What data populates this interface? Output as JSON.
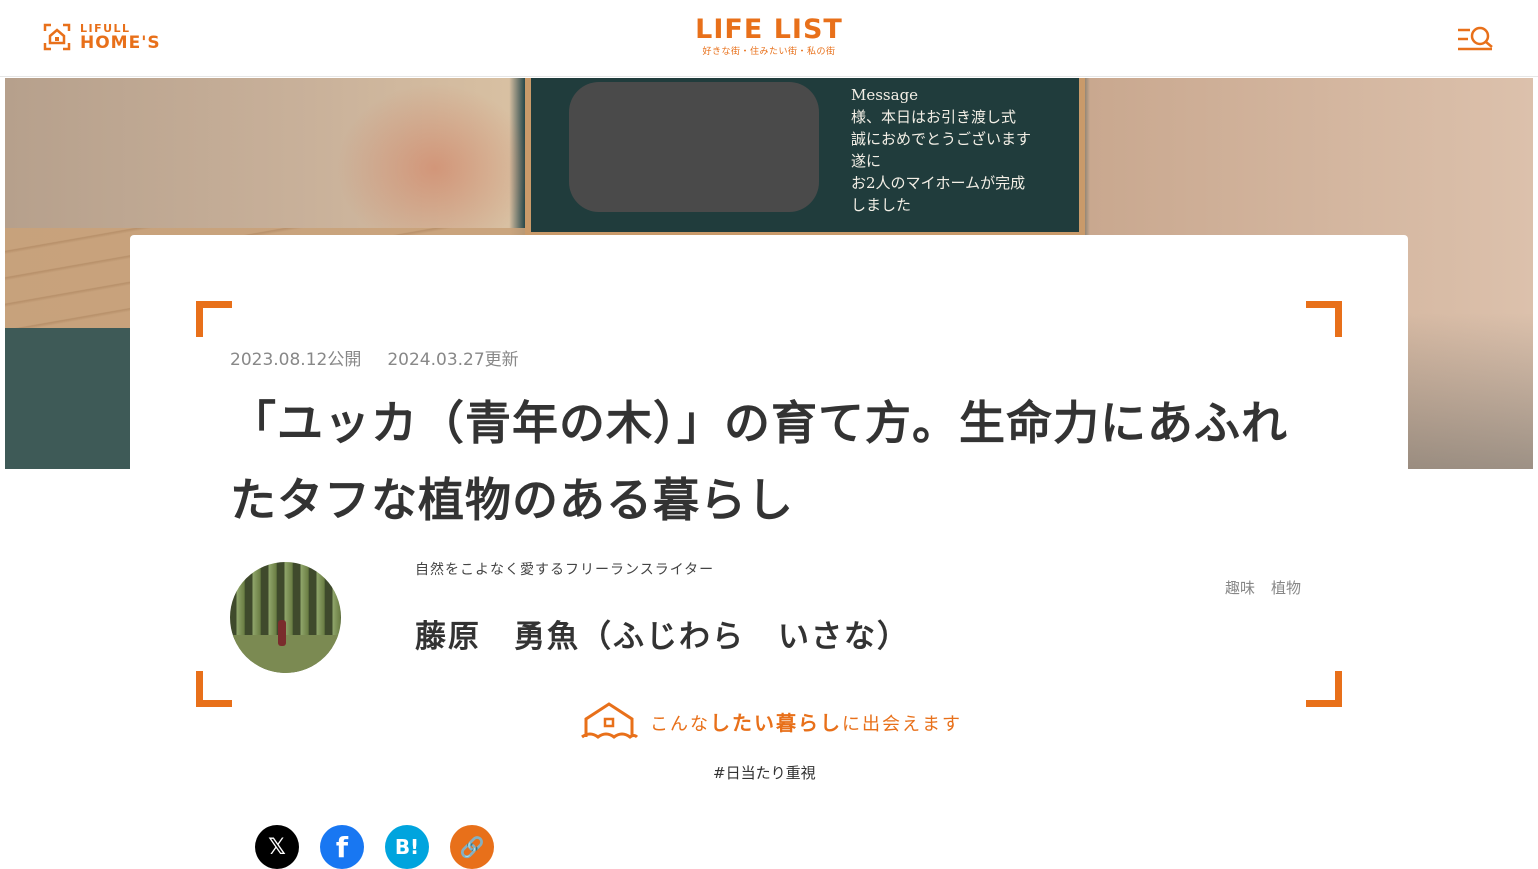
{
  "header": {
    "brand_sub": "LIFULL",
    "brand_main": "HOME'S",
    "logo_main": "LIFE LIST",
    "logo_sub": "好きな街・住みたい街・私の街",
    "menu_icon": "menu-search-icon"
  },
  "hero": {
    "board_lines": [
      "Message",
      "様、本日はお引き渡し式",
      "誠におめでとうございます",
      "遂に",
      "お2人のマイホームが完成",
      "しました"
    ]
  },
  "article": {
    "published": "2023.08.12公開",
    "updated": "2024.03.27更新",
    "title": "「ユッカ（青年の木）」の育て方。生命力にあふれたタフな植物のある暮らし",
    "author_role": "自然をこよなく愛するフリーランスライター",
    "author_name": "藤原　勇魚（ふじわら　いさな）",
    "tags": [
      "趣味",
      "植物"
    ],
    "cta_prefix": "こんな",
    "cta_strong": "したい暮らし",
    "cta_suffix": "に出会えます",
    "hashtag": "#日当たり重視"
  },
  "share": {
    "x": "𝕏",
    "facebook": "f",
    "hatena": "B!",
    "link": "🔗"
  },
  "colors": {
    "accent": "#e8701a",
    "text": "#333333",
    "muted": "#888888"
  }
}
